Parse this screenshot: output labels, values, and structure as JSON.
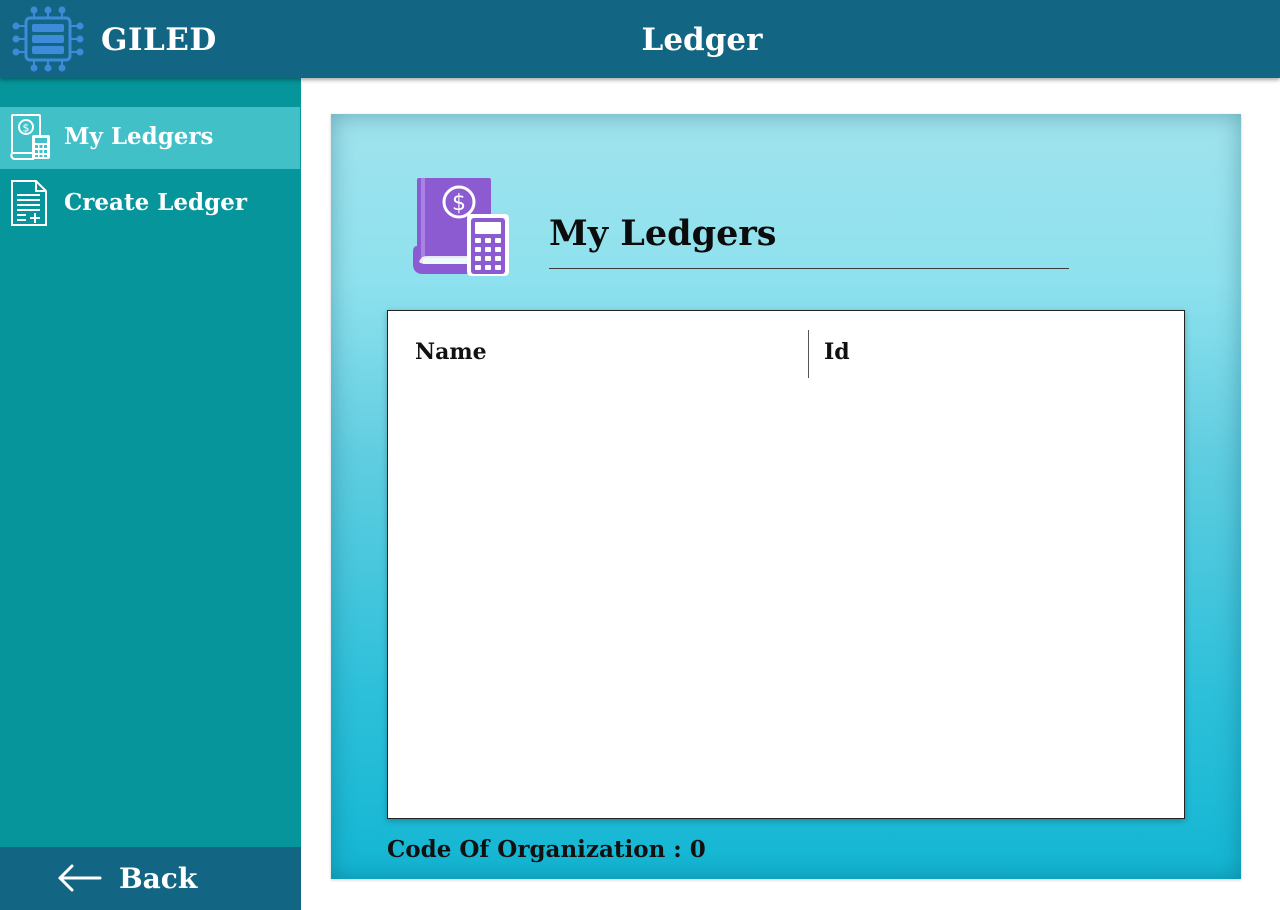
{
  "header": {
    "app_name": "GILED",
    "logo_icon": "blockchain-server-icon",
    "title": "Ledger",
    "bar_color": "#136683"
  },
  "sidebar": {
    "background": "#05959b",
    "active_color": "#42c0c8",
    "items": [
      {
        "label": "My Ledgers",
        "icon": "ledger-calculator-icon",
        "active": true
      },
      {
        "label": "Create Ledger",
        "icon": "add-document-icon",
        "active": false
      }
    ],
    "back": {
      "label": "Back",
      "icon": "arrow-left-icon"
    }
  },
  "main": {
    "icon": "ledger-calculator-icon",
    "icon_color": "#8c5ad1",
    "title": "My Ledgers",
    "table": {
      "columns": [
        "Name",
        "Id"
      ],
      "rows": []
    },
    "footer_label": "Code Of Organization : 0"
  }
}
